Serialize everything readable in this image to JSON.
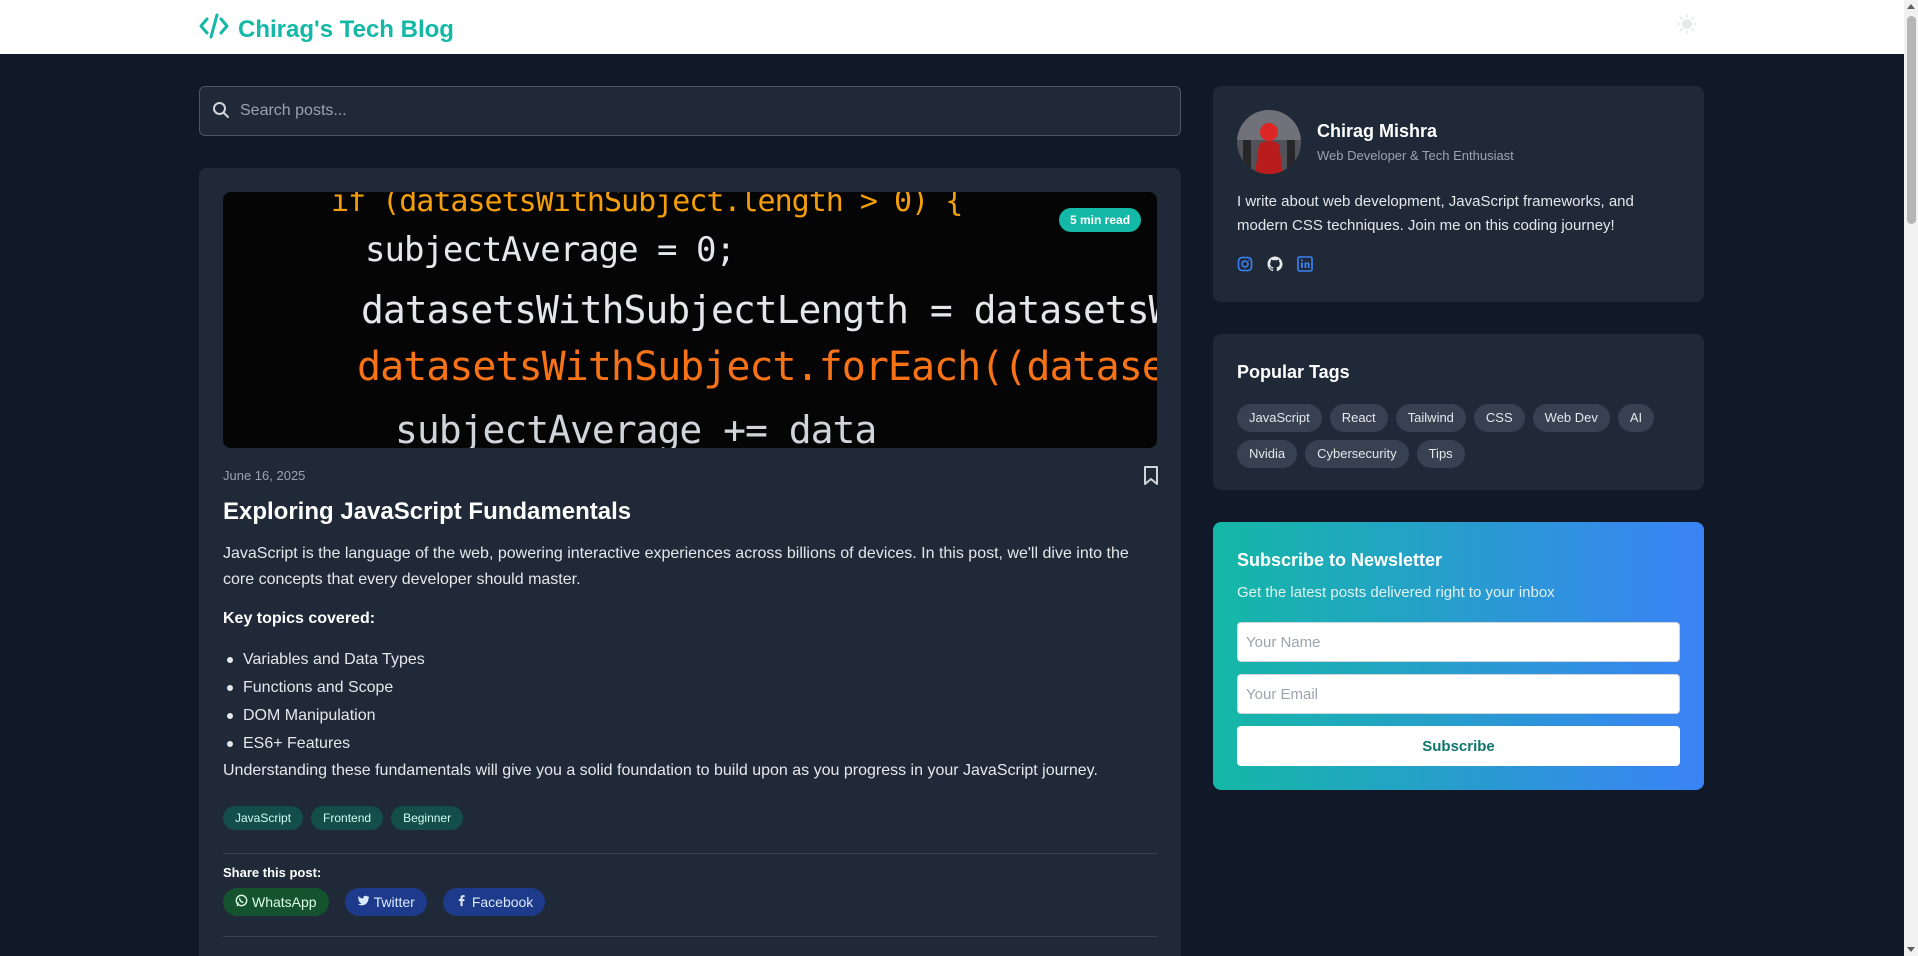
{
  "header": {
    "brand_title": "Chirag's Tech Blog",
    "brand_icon": "code-icon",
    "theme_toggle_icon": "sun-icon"
  },
  "search": {
    "placeholder": "Search posts..."
  },
  "post": {
    "image_code_lines": [
      "if (datasetsWithSubject.length > 0) {",
      "subjectAverage = 0;",
      "datasetsWithSubjectLength = datasetsWithSu",
      "datasetsWithSubject.forEach((dataset) => {",
      "subjectAverage += data"
    ],
    "read_time": "5 min read",
    "date": "June 16, 2025",
    "title": "Exploring JavaScript Fundamentals",
    "intro": "JavaScript is the language of the web, powering interactive experiences across billions of devices. In this post, we'll dive into the core concepts that every developer should master.",
    "key_topics_label": "Key topics covered:",
    "topics": [
      "Variables and Data Types",
      "Functions and Scope",
      "DOM Manipulation",
      "ES6+ Features"
    ],
    "outro": "Understanding these fundamentals will give you a solid foundation to build upon as you progress in your JavaScript journey.",
    "tags": [
      "JavaScript",
      "Frontend",
      "Beginner"
    ],
    "share_label": "Share this post:",
    "share": {
      "whatsapp": "WhatsApp",
      "twitter": "Twitter",
      "facebook": "Facebook"
    }
  },
  "profile": {
    "name": "Chirag Mishra",
    "role": "Web Developer & Tech Enthusiast",
    "bio": "I write about web development, JavaScript frameworks, and modern CSS techniques. Join me on this coding journey!",
    "socials": [
      "instagram-icon",
      "github-icon",
      "linkedin-icon"
    ]
  },
  "popular_tags": {
    "title": "Popular Tags",
    "tags": [
      "JavaScript",
      "React",
      "Tailwind",
      "CSS",
      "Web Dev",
      "AI",
      "Nvidia",
      "Cybersecurity",
      "Tips"
    ]
  },
  "newsletter": {
    "title": "Subscribe to Newsletter",
    "subtitle": "Get the latest posts delivered right to your inbox",
    "name_placeholder": "Your Name",
    "email_placeholder": "Your Email",
    "button_label": "Subscribe"
  },
  "colors": {
    "page_bg": "#111827",
    "card_bg": "#1f2937",
    "accent": "#14b8a6",
    "newsletter_gradient_start": "#14b8a6",
    "newsletter_gradient_end": "#3b82f6"
  }
}
